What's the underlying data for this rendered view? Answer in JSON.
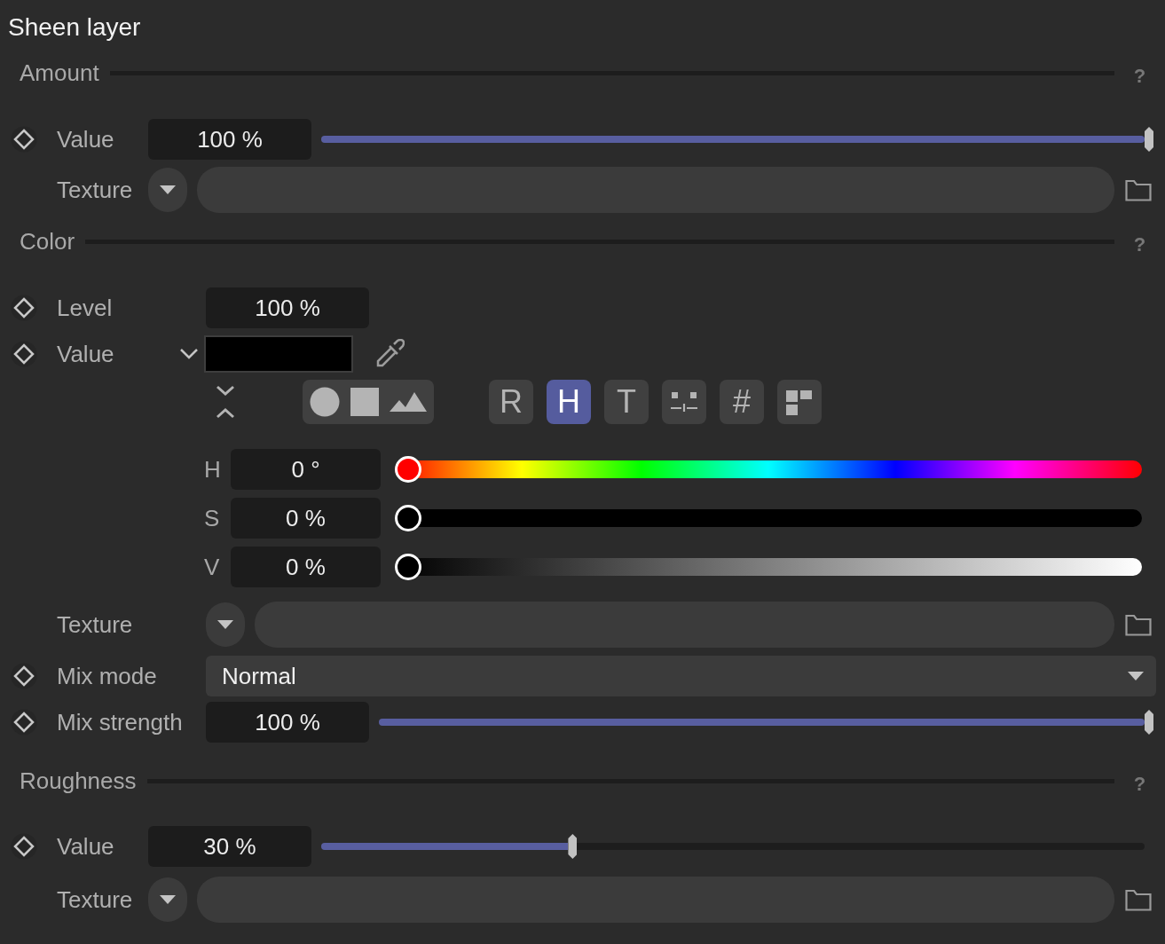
{
  "title": "Sheen layer",
  "amount": {
    "header": "Amount",
    "help": "?",
    "value": {
      "label": "Value",
      "field": "100 %",
      "level": 1
    },
    "texture": {
      "label": "Texture"
    }
  },
  "color": {
    "header": "Color",
    "help": "?",
    "level": {
      "label": "Level",
      "field": "100 %"
    },
    "value": {
      "label": "Value"
    },
    "mode_buttons": [
      {
        "kind": "text",
        "label": "R",
        "selected": false
      },
      {
        "kind": "text",
        "label": "H",
        "selected": true
      },
      {
        "kind": "text",
        "label": "T",
        "selected": false
      },
      {
        "kind": "sliders",
        "selected": false
      },
      {
        "kind": "text",
        "label": "#",
        "selected": false
      },
      {
        "kind": "swatches",
        "selected": false
      }
    ],
    "hsv": [
      {
        "kind": "hue",
        "label": "H",
        "field": "0 °",
        "level": 0
      },
      {
        "kind": "saturation",
        "label": "S",
        "field": "0 %",
        "level": 0
      },
      {
        "kind": "value",
        "label": "V",
        "field": "0 %",
        "level": 0
      }
    ],
    "texture": {
      "label": "Texture"
    },
    "mix_mode": {
      "label": "Mix mode",
      "value": "Normal"
    },
    "mix_strength": {
      "label": "Mix strength",
      "field": "100 %",
      "level": 1
    }
  },
  "roughness": {
    "header": "Roughness",
    "help": "?",
    "value": {
      "label": "Value",
      "field": "30 %",
      "level": 0.3
    },
    "texture": {
      "label": "Texture"
    }
  }
}
